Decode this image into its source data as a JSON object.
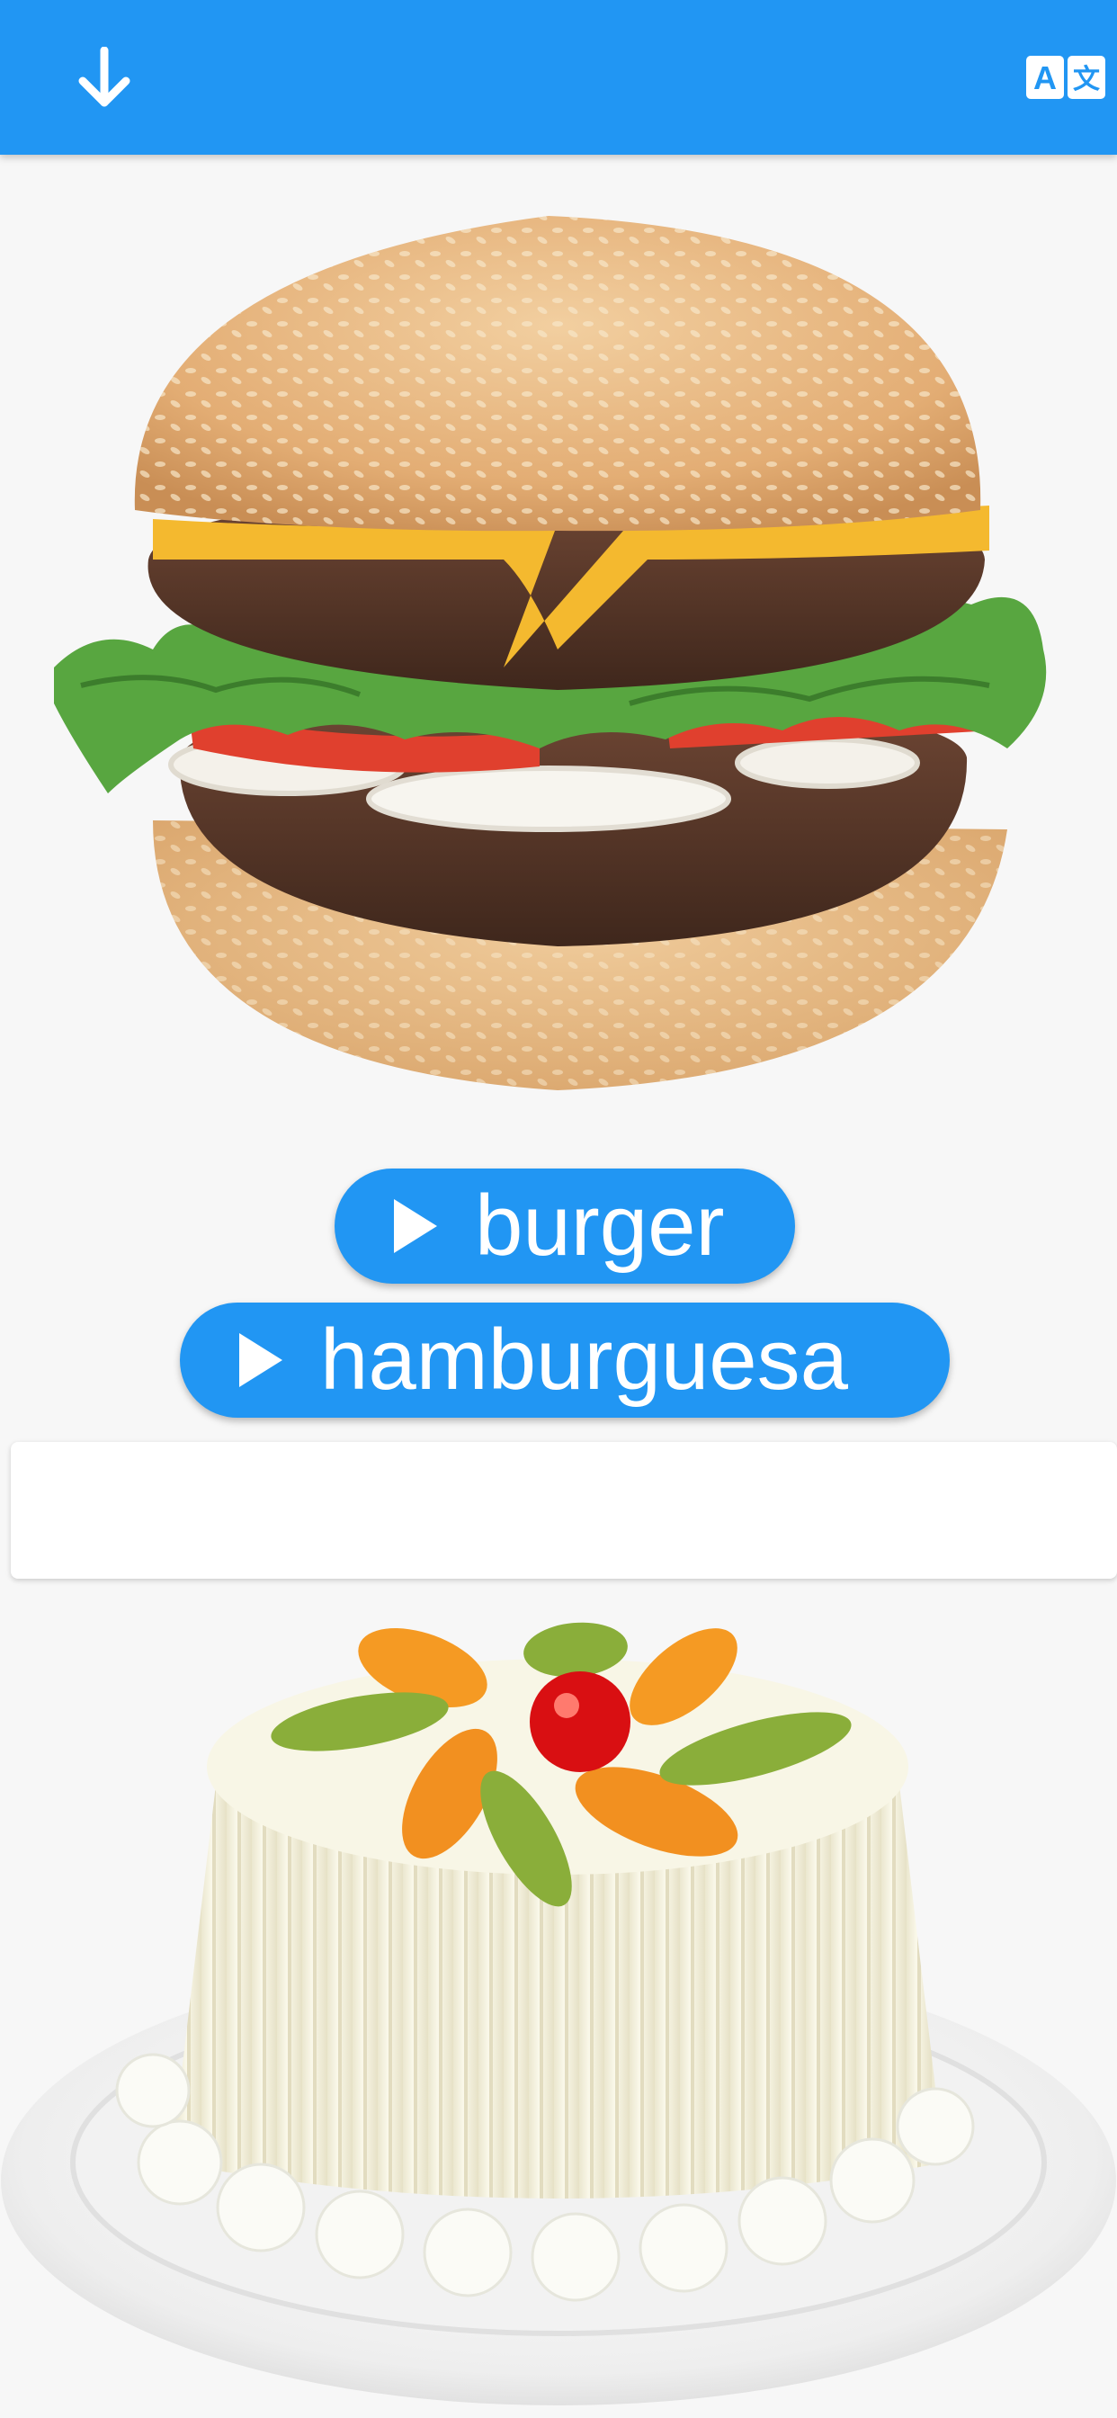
{
  "appbar": {
    "color": "#2196f3",
    "left_icon": "arrow-down-icon",
    "right_icon": "translate-icon",
    "translate_glyphs": [
      "A",
      "文"
    ]
  },
  "cards": [
    {
      "image": "burger-photo",
      "words": [
        {
          "label": "burger",
          "icon": "play-icon"
        },
        {
          "label": "hamburguesa",
          "icon": "play-icon"
        }
      ]
    },
    {
      "image": "cake-photo",
      "words": []
    }
  ]
}
